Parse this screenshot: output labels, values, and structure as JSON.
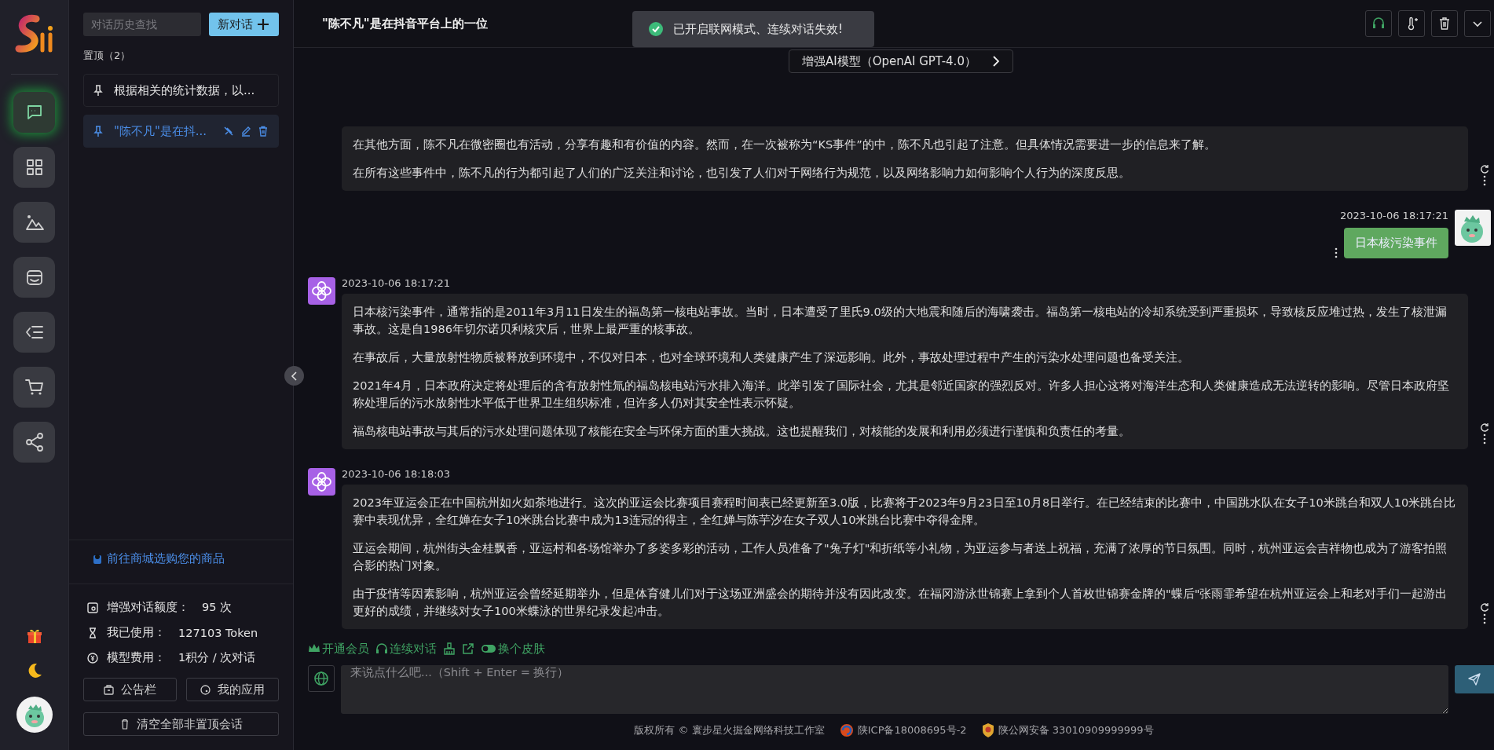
{
  "rail": {
    "items": [
      {
        "selected": true
      },
      {
        "selected": false
      },
      {
        "selected": false
      },
      {
        "selected": false
      },
      {
        "selected": false
      },
      {
        "selected": false
      },
      {
        "selected": false
      }
    ]
  },
  "sidebar": {
    "search": {
      "placeholder": "对话历史查找"
    },
    "new_button": "新对话",
    "pinned_label": "置顶（2）",
    "conversations": [
      {
        "title": "根据相关的统计数据，以...",
        "selected": false
      },
      {
        "title": "\"陈不凡\"是在抖...",
        "selected": true
      }
    ],
    "shop_link": "前往商城选购您的商品",
    "stats": [
      {
        "label": "增强对话额度：",
        "value": "95 次"
      },
      {
        "label": "我已使用：",
        "value": "127103 Token"
      },
      {
        "label": "模型费用：",
        "value": "1积分 / 次对话"
      }
    ],
    "buttons": [
      "公告栏",
      "我的应用"
    ],
    "clear_button": "清空全部非置顶会话"
  },
  "header": {
    "title": "\"陈不凡\"是在抖音平台上的一位",
    "toast": "已开启联网模式、连续对话失效!",
    "model_tooltip": "增强AI模型（OpenAI GPT-4.0）"
  },
  "messages": [
    {
      "kind": "assistant",
      "paragraphs": [
        "在其他方面，陈不凡在微密圈也有活动，分享有趣和有价值的内容。然而，在一次被称为“KS事件”的中，陈不凡也引起了注意。但具体情况需要进一步的信息来了解。",
        "在所有这些事件中，陈不凡的行为都引起了人们的广泛关注和讨论，也引发了人们对于网络行为规范，以及网络影响力如何影响个人行为的深度反思。"
      ]
    },
    {
      "kind": "user",
      "time": "2023-10-06 18:17:21",
      "paragraphs": [
        "日本核污染事件"
      ]
    },
    {
      "kind": "assistant",
      "time": "2023-10-06 18:17:21",
      "paragraphs": [
        "日本核污染事件，通常指的是2011年3月11日发生的福岛第一核电站事故。当时，日本遭受了里氏9.0级的大地震和随后的海啸袭击。福岛第一核电站的冷却系统受到严重损坏，导致核反应堆过热，发生了核泄漏事故。这是自1986年切尔诺贝利核灾后，世界上最严重的核事故。",
        "在事故后，大量放射性物质被释放到环境中，不仅对日本，也对全球环境和人类健康产生了深远影响。此外，事故处理过程中产生的污染水处理问题也备受关注。",
        "2021年4月，日本政府决定将处理后的含有放射性氚的福岛核电站污水排入海洋。此举引发了国际社会，尤其是邻近国家的强烈反对。许多人担心这将对海洋生态和人类健康造成无法逆转的影响。尽管日本政府坚称处理后的污水放射性水平低于世界卫生组织标准，但许多人仍对其安全性表示怀疑。",
        "福岛核电站事故与其后的污水处理问题体现了核能在安全与环保方面的重大挑战。这也提醒我们，对核能的发展和利用必须进行谨慎和负责任的考量。"
      ]
    },
    {
      "kind": "assistant",
      "time": "2023-10-06 18:18:03",
      "paragraphs": [
        "2023年亚运会正在中国杭州如火如荼地进行。这次的亚运会比赛项目赛程时间表已经更新至3.0版，比赛将于2023年9月23日至10月8日举行。在已经结束的比赛中，中国跳水队在女子10米跳台和双人10米跳台比赛中表现优异，全红婵在女子10米跳台比赛中成为13连冠的得主，全红婵与陈芋汐在女子双人10米跳台比赛中夺得金牌。",
        "亚运会期间，杭州街头金桂飘香，亚运村和各场馆举办了多姿多彩的活动，工作人员准备了\"兔子灯\"和折纸等小礼物，为亚运参与者送上祝福，充满了浓厚的节日氛围。同时，杭州亚运会吉祥物也成为了游客拍照合影的热门对象。",
        "由于疫情等因素影响，杭州亚运会曾经延期举办，但是体育健儿们对于这场亚洲盛会的期待并没有因此改变。在福冈游泳世锦赛上拿到个人首枚世锦赛金牌的\"蝶后\"张雨霏希望在杭州亚运会上和老对手们一起游出更好的成绩，并继续对女子100米蝶泳的世界纪录发起冲击。"
      ]
    }
  ],
  "toolbar": [
    {
      "kind": "crown",
      "label": "开通会员"
    },
    {
      "kind": "headset",
      "label": "连续对话"
    },
    {
      "kind": "broom"
    },
    {
      "kind": "export"
    },
    {
      "kind": "toggle",
      "label": "换个皮肤"
    }
  ],
  "input": {
    "placeholder": "来说点什么吧...（Shift + Enter = 换行）"
  },
  "footer": {
    "copyright": "版权所有 © 寰步星火掘金网络科技工作室",
    "icp": "陕ICP备18008695号-2",
    "police": "陕公网安备 33010909999999号"
  }
}
